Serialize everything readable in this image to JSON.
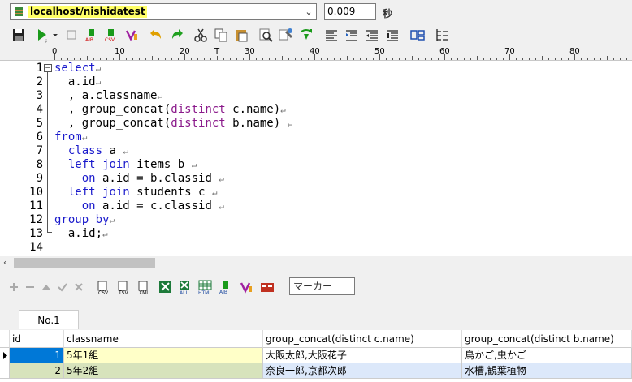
{
  "connection": {
    "name": "localhost/nishidatest"
  },
  "timing": {
    "value": "0.009",
    "unit": "秒"
  },
  "ruler": {
    "labels": [
      "0",
      "10",
      "20",
      "30",
      "40",
      "50",
      "60",
      "70",
      "80"
    ]
  },
  "editor": {
    "line_numbers": [
      "1",
      "2",
      "3",
      "4",
      "5",
      "6",
      "7",
      "8",
      "9",
      "10",
      "11",
      "12",
      "13",
      "14"
    ]
  },
  "result_toolbar": {
    "marker_label": "マーカー"
  },
  "tabs": [
    {
      "label": "No.1"
    }
  ],
  "grid": {
    "columns": [
      "id",
      "classname",
      "group_concat(distinct c.name)",
      "group_concat(distinct b.name)"
    ],
    "rows": [
      {
        "id": "1",
        "classname": "5年1組",
        "c_names": "大阪太郎,大阪花子",
        "b_names": "鳥かご,虫かご"
      },
      {
        "id": "2",
        "classname": "5年2組",
        "c_names": "奈良一郎,京都次郎",
        "b_names": "水槽,観葉植物"
      }
    ]
  },
  "colors": {
    "connection_highlight": "#ffff66",
    "selected_cell": "#0078d7",
    "classname_row1": "#ffffc8",
    "row2_bg": "#d7e3bc",
    "row2_alt": "#dce8fa"
  }
}
